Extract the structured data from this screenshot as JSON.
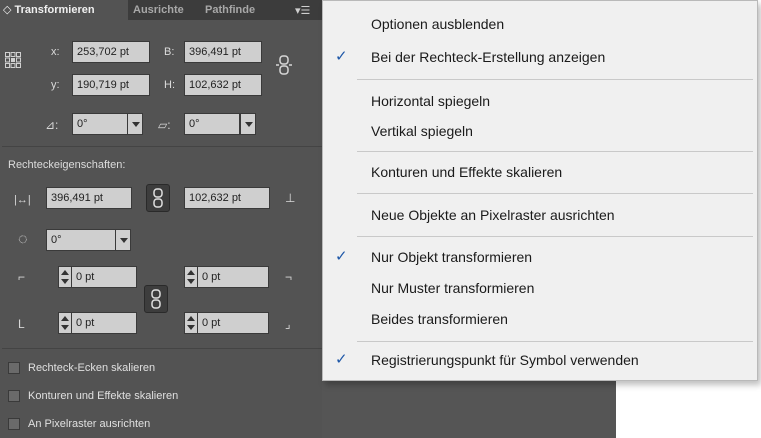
{
  "panel": {
    "tabs": [
      "◇ Transformieren",
      "Ausrichte",
      "Pathfinde"
    ],
    "x_label": "x:",
    "x_value": "253,702 pt",
    "b_label": "B:",
    "b_value": "396,491 pt",
    "y_label": "y:",
    "y_value": "190,719 pt",
    "h_label": "H:",
    "h_value": "102,632 pt",
    "rotate_value": "0°",
    "shear_value": "0°",
    "rect_props_label": "Rechteckeigenschaften:",
    "rect_width": "396,491 pt",
    "rect_height": "102,632 pt",
    "rect_rotation": "0°",
    "corner_tl": "0 pt",
    "corner_tr": "0 pt",
    "corner_bl": "0 pt",
    "corner_br": "0 pt",
    "checkboxes": [
      "Rechteck-Ecken skalieren",
      "Konturen und Effekte skalieren",
      "An Pixelraster ausrichten"
    ]
  },
  "menu": {
    "items": [
      {
        "label": "Optionen ausblenden",
        "checked": false
      },
      {
        "label": "Bei der Rechteck-Erstellung anzeigen",
        "checked": true
      },
      {
        "label": "Horizontal spiegeln",
        "checked": false
      },
      {
        "label": "Vertikal spiegeln",
        "checked": false
      },
      {
        "label": "Konturen und Effekte skalieren",
        "checked": false
      },
      {
        "label": "Neue Objekte an Pixelraster ausrichten",
        "checked": false
      },
      {
        "label": "Nur Objekt transformieren",
        "checked": true
      },
      {
        "label": "Nur Muster transformieren",
        "checked": false
      },
      {
        "label": "Beides transformieren",
        "checked": false
      },
      {
        "label": "Registrierungspunkt für Symbol verwenden",
        "checked": true
      }
    ],
    "check_glyph": "✓"
  },
  "colors": {
    "panel_bg": "#535353",
    "menu_bg": "#f0f0f0",
    "check": "#1f58a8"
  }
}
